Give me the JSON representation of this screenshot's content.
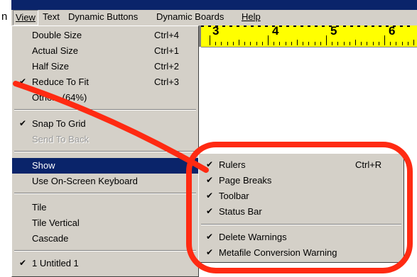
{
  "menubar": {
    "cut_letter": "n",
    "items": [
      "View",
      "Text",
      "Dynamic Buttons",
      "Dynamic Boards",
      "Help"
    ]
  },
  "ruler": {
    "numbers": [
      "3",
      "4",
      "5",
      "6"
    ]
  },
  "view_menu": {
    "zoom_items": [
      {
        "label": "Double Size",
        "shortcut": "Ctrl+4",
        "checked": false
      },
      {
        "label": "Actual Size",
        "shortcut": "Ctrl+1",
        "checked": false
      },
      {
        "label": "Half Size",
        "shortcut": "Ctrl+2",
        "checked": false
      },
      {
        "label": "Reduce To Fit",
        "shortcut": "Ctrl+3",
        "checked": true
      },
      {
        "label": "Other...(64%)",
        "shortcut": "",
        "checked": false
      }
    ],
    "snap_to_grid": "Snap To Grid",
    "send_to_back": "Send To Back",
    "show": "Show",
    "on_screen_keyboard": "Use On-Screen Keyboard",
    "tile": "Tile",
    "tile_vertical": "Tile Vertical",
    "cascade": "Cascade",
    "window_1": "1 Untitled 1"
  },
  "show_submenu": {
    "items": [
      {
        "label": "Rulers",
        "shortcut": "Ctrl+R",
        "checked": true
      },
      {
        "label": "Page Breaks",
        "shortcut": "",
        "checked": true
      },
      {
        "label": "Toolbar",
        "shortcut": "",
        "checked": true
      },
      {
        "label": "Status Bar",
        "shortcut": "",
        "checked": true
      },
      {
        "label": "Delete Warnings",
        "shortcut": "",
        "checked": true
      },
      {
        "label": "Metafile Conversion Warning",
        "shortcut": "",
        "checked": true
      }
    ]
  },
  "colors": {
    "menu_bg": "#d4d0c8",
    "highlight": "#0a246a",
    "ruler": "#ffff00",
    "annotation": "#ff2a12"
  },
  "check_glyph": "✔"
}
